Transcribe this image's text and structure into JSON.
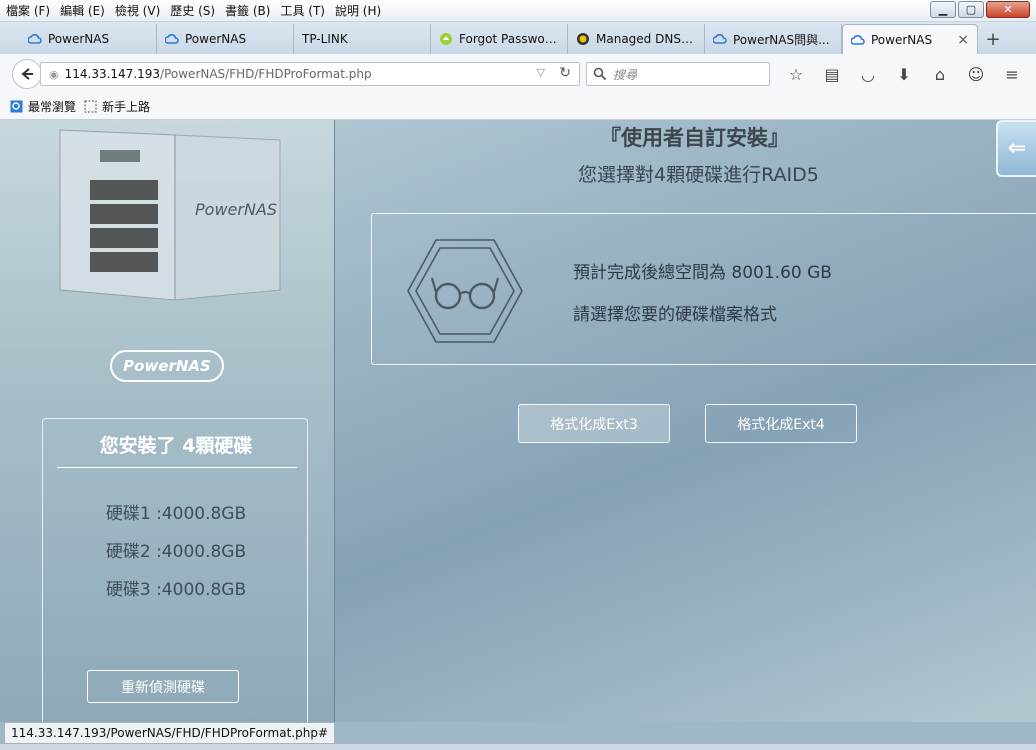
{
  "menubar": {
    "items": [
      "檔案 (F)",
      "編輯 (E)",
      "檢視 (V)",
      "歷史 (S)",
      "書籤 (B)",
      "工具 (T)",
      "說明 (H)"
    ]
  },
  "window_controls": {
    "minimize": "▁",
    "maximize": "▢",
    "close": "✕"
  },
  "tabs": [
    {
      "label": "PowerNAS",
      "icon": "cloud-icon"
    },
    {
      "label": "PowerNAS",
      "icon": "cloud-icon"
    },
    {
      "label": "TP-LINK",
      "icon": ""
    },
    {
      "label": "Forgot Passwor...",
      "icon": "leaf-icon"
    },
    {
      "label": "Managed DNS ...",
      "icon": "globe-icon"
    },
    {
      "label": "PowerNAS問與...",
      "icon": "cloud-icon"
    },
    {
      "label": "PowerNAS",
      "icon": "cloud-icon",
      "active": true
    }
  ],
  "tab_close": "×",
  "new_tab": "+",
  "navbar": {
    "url_host": "114.33.147.193",
    "url_path": "/PowerNAS/FHD/FHDProFormat.php",
    "search_placeholder": "搜尋"
  },
  "bookmarks": [
    {
      "label": "最常瀏覽",
      "icon": "search-bookmark-icon"
    },
    {
      "label": "新手上路",
      "icon": "dashed-box-icon"
    }
  ],
  "left_panel": {
    "logo_text": "PowerNAS",
    "disk_title": "您安裝了 4顆硬碟",
    "disks": [
      "硬碟1 :4000.8GB",
      "硬碟2 :4000.8GB",
      "硬碟3 :4000.8GB"
    ],
    "redetect_label": "重新偵測硬碟"
  },
  "main": {
    "title": "『使用者自訂安裝』",
    "subtitle": "您選擇對4顆硬碟進行RAID5",
    "info_line1": "預計完成後總空間為 8001.60 GB",
    "info_line2": "請選擇您要的硬碟檔案格式",
    "btn_ext3": "格式化成Ext3",
    "btn_ext4": "格式化成Ext4",
    "back_arrow": "⇐"
  },
  "statusbar": {
    "text": "114.33.147.193/PowerNAS/FHD/FHDProFormat.php#"
  },
  "colors": {
    "text_dark": "#3b4650",
    "panel_border": "#f0f6f8",
    "accent_blue": "#8fb8d6"
  }
}
